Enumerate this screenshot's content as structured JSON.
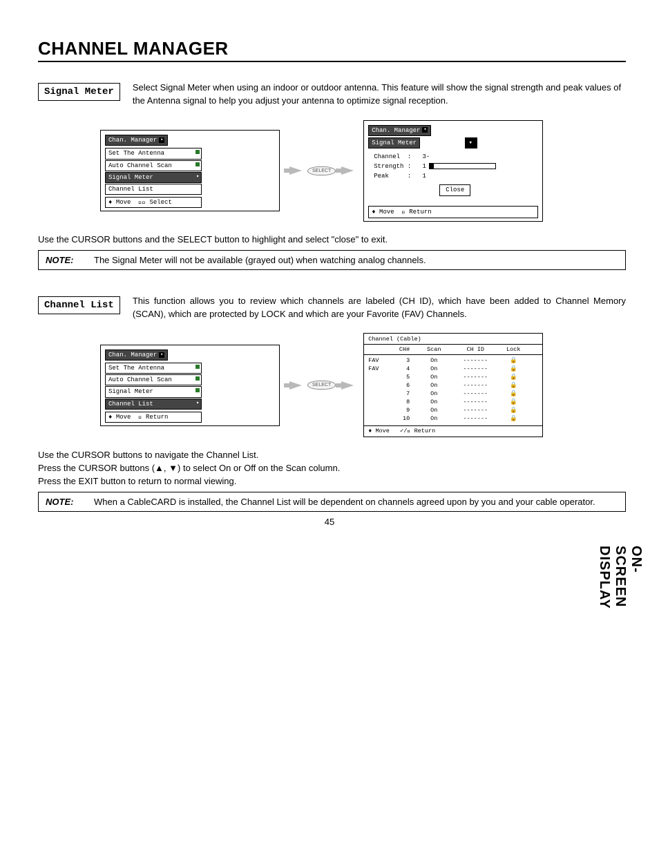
{
  "page": {
    "title": "CHANNEL MANAGER",
    "side_label": "ON-SCREEN DISPLAY",
    "number": "45"
  },
  "signal_meter": {
    "label": "Signal Meter",
    "description": "Select Signal Meter when using an indoor or outdoor antenna.  This feature will show the signal strength and peak values of the Antenna signal to help  you adjust your antenna to optimize signal reception.",
    "menu1": {
      "title": "Chan. Manager",
      "items": [
        "Set The Antenna",
        "Auto Channel Scan",
        "Signal Meter",
        "Channel List"
      ],
      "selected_index": 2,
      "hint": "Move",
      "hint2": "Select"
    },
    "select_btn": "SELECT",
    "menu2": {
      "title": "Chan. Manager",
      "subtitle": "Signal Meter",
      "rows": {
        "channel_label": "Channel",
        "channel_value": "3-",
        "strength_label": "Strength",
        "strength_value": "1",
        "peak_label": "Peak",
        "peak_value": "1"
      },
      "close": "Close",
      "footer_move": "Move",
      "footer_return": "Return"
    },
    "post_text": "Use the CURSOR buttons and the SELECT button to highlight and select \"close\" to exit.",
    "note_label": "NOTE:",
    "note_text": "The Signal Meter will not be available (grayed out) when watching analog channels."
  },
  "channel_list": {
    "label": "Channel List",
    "description": "This function allows you to review which channels are labeled (CH ID), which have been added to Channel Memory (SCAN), which are protected by LOCK and which are your Favorite (FAV) Channels.",
    "menu1": {
      "title": "Chan. Manager",
      "items": [
        "Set The Antenna",
        "Auto Channel Scan",
        "Signal Meter",
        "Channel List"
      ],
      "selected_index": 3,
      "hint": "Move",
      "hint2": "Return"
    },
    "select_btn": "SELECT",
    "table": {
      "title": "Channel (Cable)",
      "cols": {
        "ch": "CH#",
        "scan": "Scan",
        "chid": "CH ID",
        "lock": "Lock"
      },
      "rows": [
        {
          "fav": "FAV",
          "ch": "3",
          "scan": "On",
          "chid": "-------",
          "lock": "🔒"
        },
        {
          "fav": "FAV",
          "ch": "4",
          "scan": "On",
          "chid": "-------",
          "lock": "🔒"
        },
        {
          "fav": "",
          "ch": "5",
          "scan": "On",
          "chid": "-------",
          "lock": "🔒"
        },
        {
          "fav": "",
          "ch": "6",
          "scan": "On",
          "chid": "-------",
          "lock": "🔒"
        },
        {
          "fav": "",
          "ch": "7",
          "scan": "On",
          "chid": "-------",
          "lock": "🔒"
        },
        {
          "fav": "",
          "ch": "8",
          "scan": "On",
          "chid": "-------",
          "lock": "🔒"
        },
        {
          "fav": "",
          "ch": "9",
          "scan": "On",
          "chid": "-------",
          "lock": "🔒"
        },
        {
          "fav": "",
          "ch": "10",
          "scan": "On",
          "chid": "-------",
          "lock": "🔒"
        }
      ],
      "footer_move": "Move",
      "footer_return": "Return"
    },
    "post1": "Use the CURSOR buttons to navigate the Channel List.",
    "post2": "Press the CURSOR buttons (▲, ▼) to select On or Off on the Scan column.",
    "post3": "Press the EXIT button to return to normal viewing.",
    "note_label": "NOTE:",
    "note_text": "When a CableCARD is installed, the Channel List will be dependent on channels agreed upon by you and your cable operator."
  }
}
